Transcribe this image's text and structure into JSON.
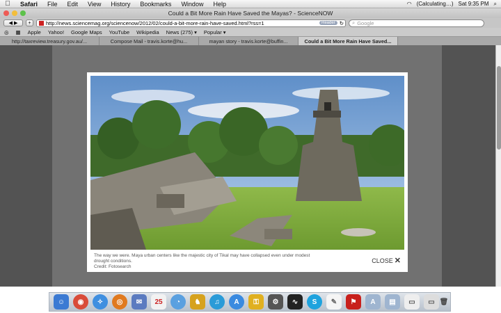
{
  "menubar": {
    "items": [
      "Safari",
      "File",
      "Edit",
      "View",
      "History",
      "Bookmarks",
      "Window",
      "Help"
    ],
    "status": "(Calculating…)",
    "clock": "Sat 9:35 PM"
  },
  "window": {
    "title": "Could a Bit More Rain Have Saved the Mayas? - ScienceNOW"
  },
  "nav": {
    "url": "http://news.sciencemag.org/sciencenow/2012/02/could-a-bit-more-rain-have-saved.html?rss=1",
    "reader": "Reader",
    "search_placeholder": "Google"
  },
  "bookmarks": [
    "Apple",
    "Yahoo!",
    "Google Maps",
    "YouTube",
    "Wikipedia",
    "News (275) ▾",
    "Popular ▾"
  ],
  "tabs": [
    "http://taxreview.treasury.gov.au/...",
    "Compose Mail - travis.korte@hu...",
    "mayan story - travis.korte@buffin...",
    "Could a Bit More Rain Have Saved..."
  ],
  "modal": {
    "caption": "The way we were. Maya urban centers like the majestic city of Tikal may have collapsed even under modest drought conditions.",
    "credit": "Credit: Fotosearch",
    "close": "CLOSE"
  }
}
